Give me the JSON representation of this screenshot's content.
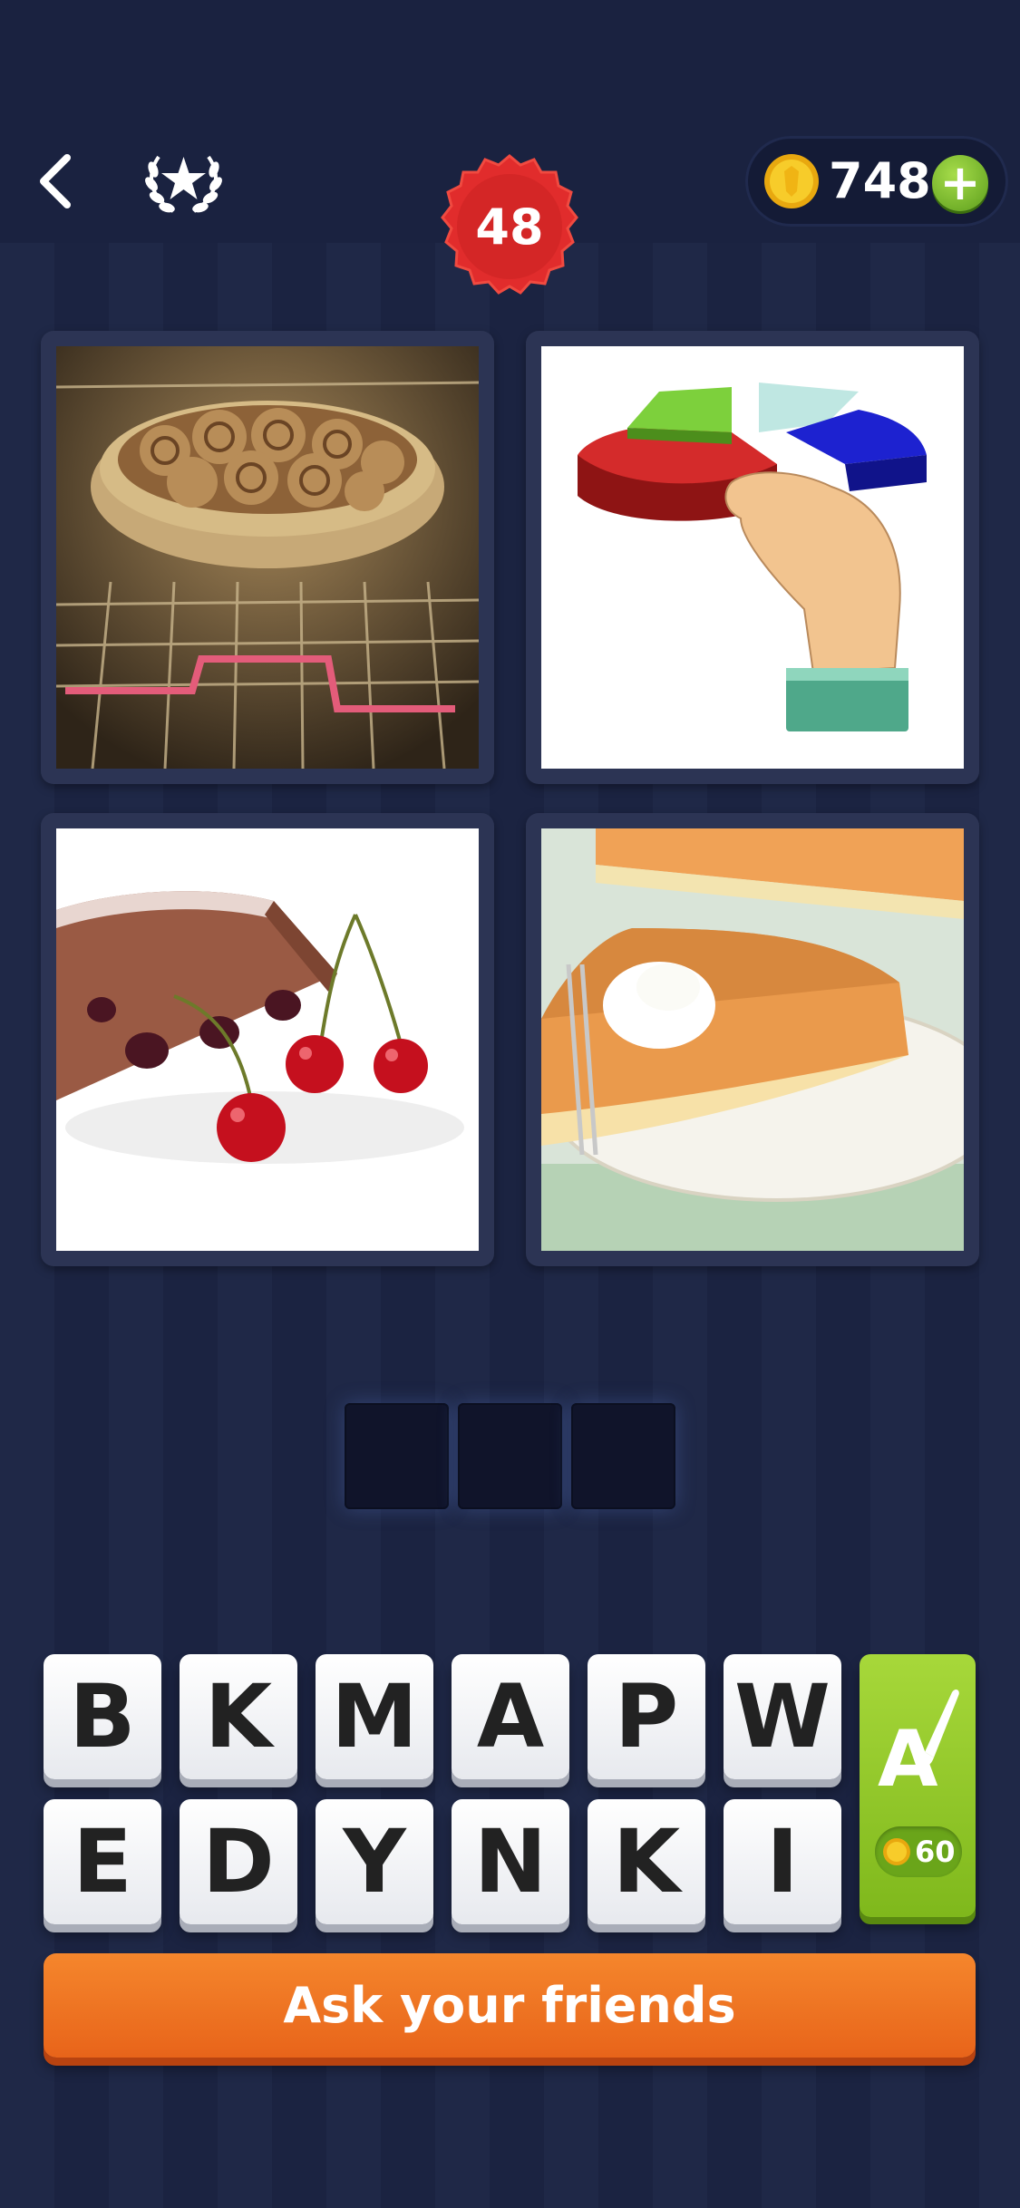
{
  "header": {
    "back_icon": "chevron-left-icon",
    "achievements_icon": "laurel-star-icon",
    "level": "48",
    "coins": "748",
    "add_coins_label": "+"
  },
  "puzzle": {
    "images": [
      "cinnamon-rolls-baking-in-oven",
      "hand-taking-slice-of-3d-pie-chart",
      "cherry-cake-slice-with-cherries",
      "pumpkin-pie-slice-with-whipped-cream"
    ],
    "answer_slots": 3
  },
  "keyboard": {
    "row1": [
      "B",
      "K",
      "M",
      "A",
      "P",
      "W"
    ],
    "row2": [
      "E",
      "D",
      "Y",
      "N",
      "K",
      "I"
    ]
  },
  "hint": {
    "icon": "letter-a-brush-icon",
    "label": "A",
    "price": "60"
  },
  "ask_button": {
    "label": "Ask your friends"
  },
  "colors": {
    "background": "#1e2644",
    "level_badge": "#e12c2c",
    "coin": "#f5c21b",
    "plus": "#7cc22c",
    "hint": "#8fc72a",
    "ask_button": "#f07a22"
  }
}
